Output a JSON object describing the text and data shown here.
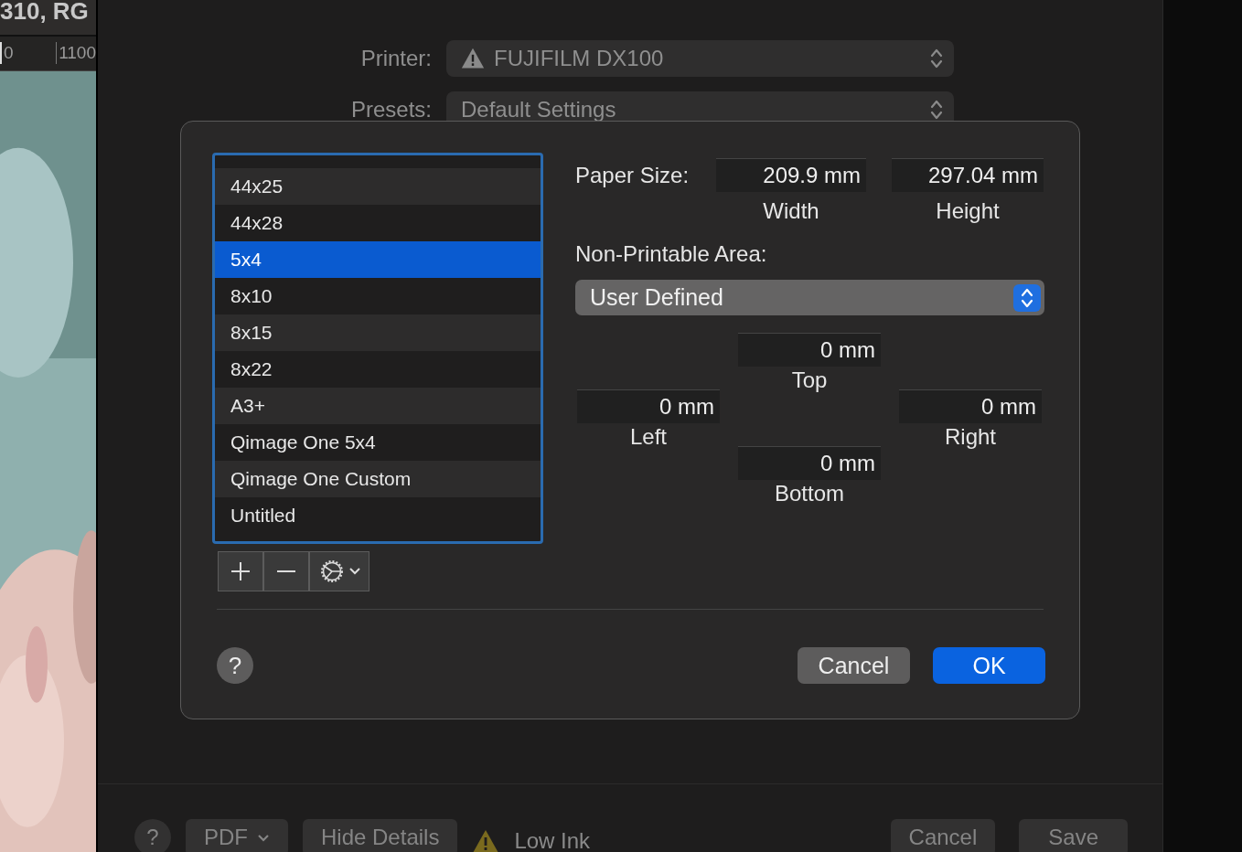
{
  "background_app": {
    "header": "310, RG",
    "ruler_labels": [
      "0",
      "1100"
    ]
  },
  "print_dialog": {
    "printer": {
      "label": "Printer:",
      "value": "FUJIFILM DX100"
    },
    "presets": {
      "label": "Presets:",
      "value": "Default Settings"
    },
    "bottom_bar": {
      "help": "?",
      "pdf": "PDF",
      "hide_details": "Hide Details",
      "status": "Low Ink",
      "cancel": "Cancel",
      "save": "Save"
    }
  },
  "paper_sheet": {
    "paper_list": [
      {
        "label": "44x25",
        "selected": false
      },
      {
        "label": "44x28",
        "selected": false
      },
      {
        "label": "5x4",
        "selected": true
      },
      {
        "label": "8x10",
        "selected": false
      },
      {
        "label": "8x15",
        "selected": false
      },
      {
        "label": "8x22",
        "selected": false
      },
      {
        "label": "A3+",
        "selected": false
      },
      {
        "label": "Qimage One 5x4",
        "selected": false
      },
      {
        "label": "Qimage One Custom",
        "selected": false
      },
      {
        "label": "Untitled",
        "selected": false
      }
    ],
    "paper_size": {
      "label": "Paper Size:",
      "width": "209.9 mm",
      "width_caption": "Width",
      "height": "297.04 mm",
      "height_caption": "Height"
    },
    "non_printable": {
      "label": "Non-Printable Area:",
      "value": "User Defined"
    },
    "margins": {
      "top": {
        "value": "0 mm",
        "caption": "Top"
      },
      "left": {
        "value": "0 mm",
        "caption": "Left"
      },
      "right": {
        "value": "0 mm",
        "caption": "Right"
      },
      "bottom": {
        "value": "0 mm",
        "caption": "Bottom"
      }
    },
    "help": "?",
    "cancel": "Cancel",
    "ok": "OK"
  }
}
